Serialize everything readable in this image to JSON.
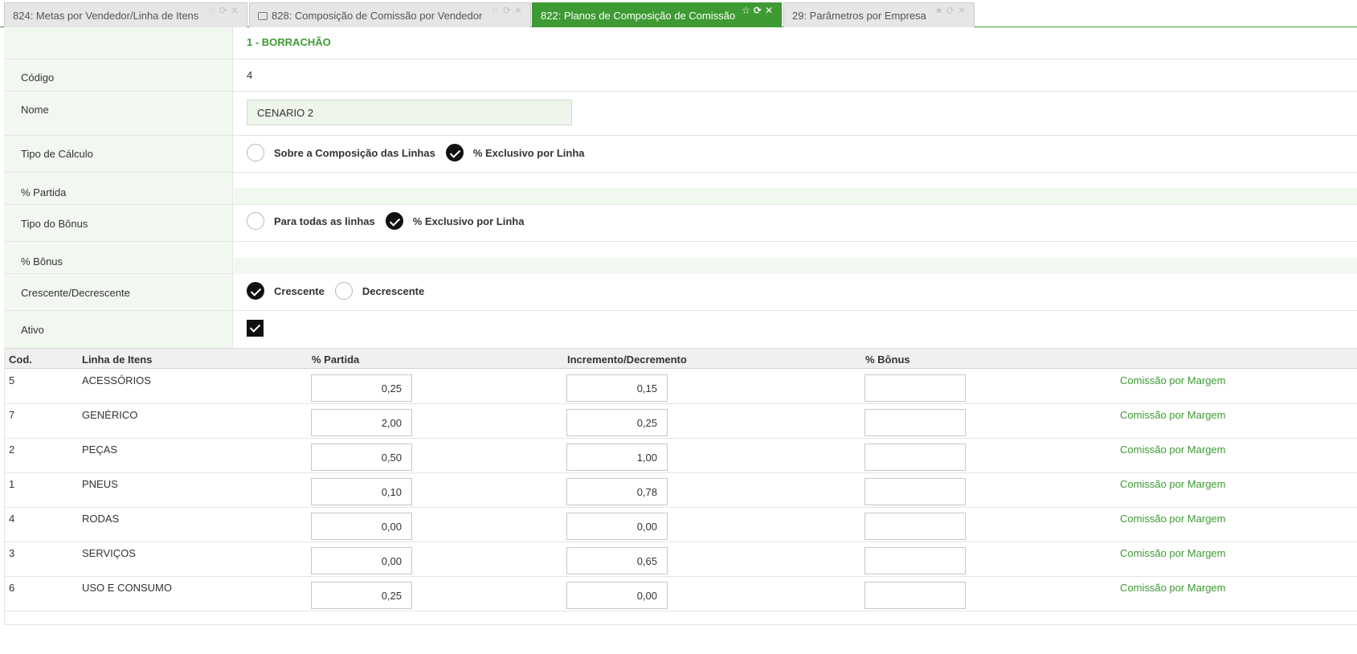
{
  "tabs": [
    {
      "label": "824: Metas por Vendedor/Linha de Itens",
      "has_printer": false,
      "active": false
    },
    {
      "label": "828: Composição de Comissão por Vendedor",
      "has_printer": true,
      "active": false
    },
    {
      "label": "822: Planos de Composição de Comissão",
      "has_printer": false,
      "active": true
    },
    {
      "label": "29: Parâmetros por Empresa",
      "has_printer": false,
      "active": false
    }
  ],
  "form": {
    "header": "1 - BORRACHÃO",
    "codigo": {
      "label": "Código",
      "value": "4"
    },
    "nome": {
      "label": "Nome",
      "value": "CENARIO 2"
    },
    "tipo_calculo": {
      "label": "Tipo de Cálculo",
      "option1": "Sobre a Composição das Linhas",
      "option2": "% Exclusivo por Linha",
      "selected": 2
    },
    "partida": {
      "label": "% Partida"
    },
    "tipo_bonus": {
      "label": "Tipo do Bônus",
      "option1": "Para todas as linhas",
      "option2": "% Exclusivo por Linha",
      "selected": 2
    },
    "bonus": {
      "label": "% Bônus"
    },
    "ordem": {
      "label": "Crescente/Decrescente",
      "option1": "Crescente",
      "option2": "Decrescente",
      "selected": 1
    },
    "ativo": {
      "label": "Ativo",
      "checked": true
    }
  },
  "grid": {
    "headers": {
      "cod": "Cod.",
      "linha": "Linha de Itens",
      "partida": "% Partida",
      "incremento": "Incremento/Decremento",
      "bonus": "% Bônus"
    },
    "rows": [
      {
        "cod": "5",
        "linha": "ACESSÓRIOS",
        "partida": "0,25",
        "incremento": "0,15",
        "bonus": "",
        "action": "Comissão por Margem"
      },
      {
        "cod": "7",
        "linha": "GENÉRICO",
        "partida": "2,00",
        "incremento": "0,25",
        "bonus": "",
        "action": "Comissão por Margem"
      },
      {
        "cod": "2",
        "linha": "PEÇAS",
        "partida": "0,50",
        "incremento": "1,00",
        "bonus": "",
        "action": "Comissão por Margem"
      },
      {
        "cod": "1",
        "linha": "PNEUS",
        "partida": "0,10",
        "incremento": "0,78",
        "bonus": "",
        "action": "Comissão por Margem"
      },
      {
        "cod": "4",
        "linha": "RODAS",
        "partida": "0,00",
        "incremento": "0,00",
        "bonus": "",
        "action": "Comissão por Margem"
      },
      {
        "cod": "3",
        "linha": "SERVIÇOS",
        "partida": "0,00",
        "incremento": "0,65",
        "bonus": "",
        "action": "Comissão por Margem"
      },
      {
        "cod": "6",
        "linha": "USO E CONSUMO",
        "partida": "0,25",
        "incremento": "0,00",
        "bonus": "",
        "action": "Comissão por Margem"
      }
    ]
  },
  "colors": {
    "accent": "#3e9a33",
    "label_bg": "#f1f8ef"
  }
}
